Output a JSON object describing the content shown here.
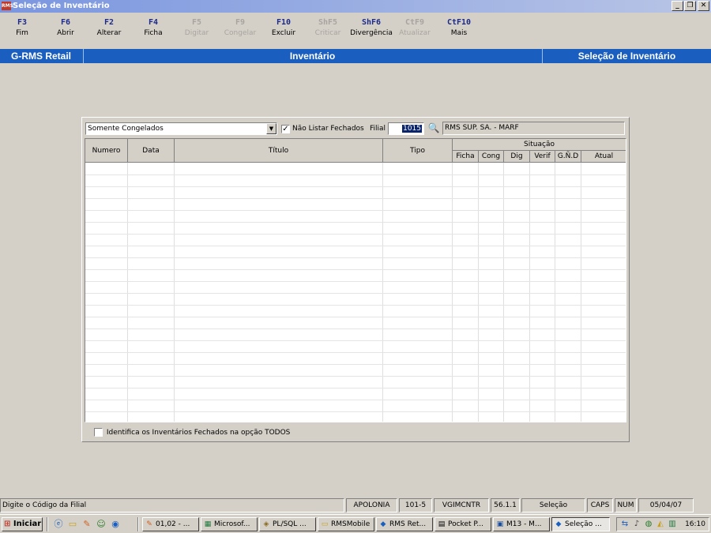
{
  "window": {
    "title": "Seleção de Inventário",
    "icon": "rms-app-icon",
    "icon_text": "RMS",
    "controls": [
      "_",
      "❐",
      "✕"
    ]
  },
  "fkeys": [
    {
      "key": "F3",
      "label": "Fim",
      "enabled": true
    },
    {
      "key": "F6",
      "label": "Abrir",
      "enabled": true
    },
    {
      "key": "F2",
      "label": "Alterar",
      "enabled": true
    },
    {
      "key": "F4",
      "label": "Ficha",
      "enabled": true
    },
    {
      "key": "F5",
      "label": "Digitar",
      "enabled": false
    },
    {
      "key": "F9",
      "label": "Congelar",
      "enabled": false
    },
    {
      "key": "F10",
      "label": "Excluir",
      "enabled": true
    },
    {
      "key": "ShF5",
      "label": "Criticar",
      "enabled": false
    },
    {
      "key": "ShF6",
      "label": "Divergência",
      "enabled": true
    },
    {
      "key": "CtF9",
      "label": "Atualizar",
      "enabled": false
    },
    {
      "key": "CtF10",
      "label": "Mais",
      "enabled": true
    }
  ],
  "header": {
    "left": "G-RMS Retail",
    "center": "Inventário",
    "right": "Seleção de Inventário"
  },
  "filter": {
    "combo_value": "Somente Congelados",
    "nao_listar_fechados_label": "Não Listar Fechados",
    "nao_listar_fechados_checked": true,
    "filial_label": "Filial",
    "filial_value": "1015",
    "filial_name": "RMS SUP. SA. - MARF"
  },
  "grid": {
    "columns": [
      "Numero",
      "Data",
      "Título",
      "Tipo"
    ],
    "group_header": "Situação",
    "sub_columns": [
      "Ficha",
      "Cong",
      "Dig",
      "Verif",
      "G.Ñ.D",
      "Atual"
    ],
    "rows": []
  },
  "footer_checkbox": {
    "label": "Identifica os Inventários Fechados na opção TODOS",
    "checked": false
  },
  "statusbar": {
    "message": "Digite o Código da Filial",
    "cells": [
      "APOLONIA",
      "101-5",
      "VGIMCNTR",
      "56.1.1",
      "Seleção",
      "CAPS",
      "NUM",
      "05/04/07"
    ]
  },
  "taskbar": {
    "start_label": "Iniciar",
    "quick_launch": [
      "ie-icon",
      "folder-icon",
      "pencil-icon",
      "people-icon",
      "globe-icon"
    ],
    "tasks": [
      {
        "label": "01,02 - ...",
        "icon": "pencil-icon",
        "active": false
      },
      {
        "label": "Microsof...",
        "icon": "excel-icon",
        "active": false
      },
      {
        "label": "PL/SQL ...",
        "icon": "db-icon",
        "active": false
      },
      {
        "label": "RMSMobile",
        "icon": "folder-icon",
        "active": false
      },
      {
        "label": "RMS Ret...",
        "icon": "rms-icon",
        "active": false
      },
      {
        "label": "Pocket P...",
        "icon": "doc-icon",
        "active": false
      },
      {
        "label": "M13 - M...",
        "icon": "word-icon",
        "active": false
      },
      {
        "label": "Seleção ...",
        "icon": "rms-icon",
        "active": true
      }
    ],
    "clock": "16:10"
  }
}
